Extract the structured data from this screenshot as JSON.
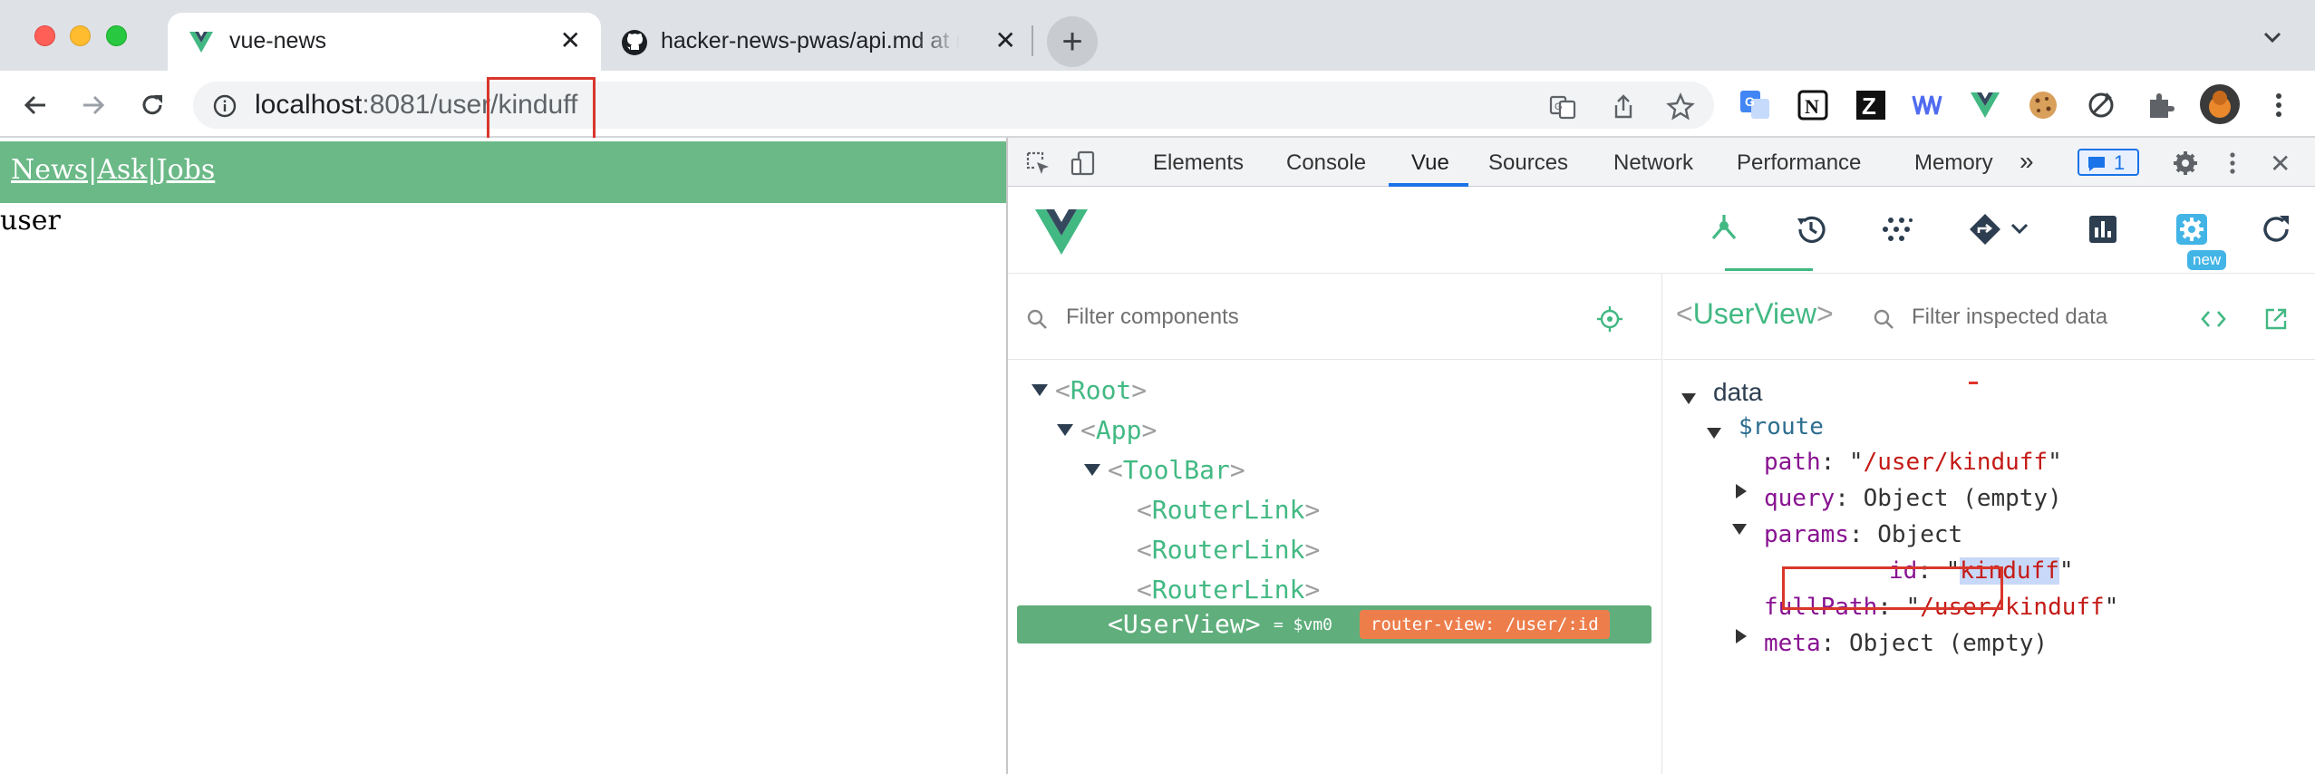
{
  "browser": {
    "tabs": [
      {
        "title": "vue-news",
        "active": true,
        "favicon": "vue-logo-icon"
      },
      {
        "title": "hacker-news-pwas/api.md at master",
        "active": false,
        "favicon": "github-icon"
      }
    ],
    "close_glyph": "✕",
    "new_tab_glyph": "+",
    "url_host": "localhost",
    "url_rest": ":8081/user/kinduff"
  },
  "page": {
    "nav": [
      "News",
      "Ask",
      "Jobs"
    ],
    "nav_sep": "|",
    "content": "user"
  },
  "devtools": {
    "tabs": [
      "Elements",
      "Console",
      "Vue",
      "Sources",
      "Network",
      "Performance",
      "Memory"
    ],
    "active_tab": "Vue",
    "more": "»",
    "message_count": "1",
    "close_glyph": "✕"
  },
  "vue": {
    "new_badge": "new",
    "component_filter_placeholder": "Filter components",
    "tree": [
      {
        "name": "Root",
        "depth": 0,
        "expanded": true
      },
      {
        "name": "App",
        "depth": 1,
        "expanded": true
      },
      {
        "name": "ToolBar",
        "depth": 2,
        "expanded": true
      },
      {
        "name": "RouterLink",
        "depth": 3
      },
      {
        "name": "RouterLink",
        "depth": 3
      },
      {
        "name": "RouterLink",
        "depth": 3
      }
    ],
    "selected": {
      "name": "UserView",
      "vm": "= $vm0",
      "router_view": "router-view: /user/:id"
    },
    "inspector": {
      "title": "UserView",
      "filter_placeholder": "Filter inspected data",
      "section": "data",
      "route_key": "$route",
      "path_key": "path",
      "path_val": "/user/kinduff",
      "query_key": "query",
      "query_val": "Object (empty)",
      "params_key": "params",
      "params_val": "Object",
      "id_key": "id",
      "id_val": "kinduff",
      "fullpath_key": "fullPath",
      "fullpath_val": "/user/kinduff",
      "meta_key": "meta",
      "meta_val": "Object (empty)"
    }
  },
  "colors": {
    "vue_green": "#42b983",
    "header_green": "#6bb987",
    "selection_green": "#5fae7b",
    "annotation_red": "#d9362b",
    "router_view_badge": "#ed7e4c"
  }
}
